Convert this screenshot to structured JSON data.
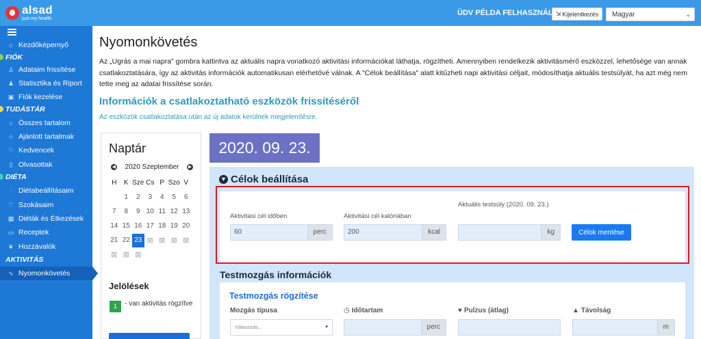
{
  "header": {
    "logo_name": "alsad",
    "logo_tagline": "just my health",
    "greeting": "ÜDV PÉLDA FELHASZNÁLÓ!",
    "logout_label": "Kijelentkezés",
    "language": "Magyar",
    "bar_color": "#3a9ae8"
  },
  "sidebar": {
    "home": "Kezdőképernyő",
    "sections": {
      "fiok": "FIÓK",
      "tudastar": "TUDÁSTÁR",
      "dieta": "DIÉTA",
      "aktivitas": "AKTIVITÁS"
    },
    "items": [
      "Adataim frissítése",
      "Statisztika és Riport",
      "Fiók kezelése",
      "Összes tartalom",
      "Ajánlott tartalmak",
      "Kedvencek",
      "Olvasottak",
      "Diétabeállításaim",
      "Szokásaim",
      "Diéták és Étkezések",
      "Receptek",
      "Hozzávalók",
      "Nyomonkövetés"
    ],
    "active": "Nyomonkövetés"
  },
  "main": {
    "title": "Nyomonkövetés",
    "intro": "Az „Ugrás a mai napra” gombra kattintva az aktuális napra vonatkozó aktivitási információkat láthatja, rögzítheti. Amennyiben rendelkezik aktivitásmérő eszközzel, lehetősége van annak csatlakoztatására, így az aktivitás információk automatikusan elérhetővé válnak. A \"Célok beállítása\" alatt kitűzheti napi aktivitási céljait, módosíthatja aktuális testsúlyát, ha azt még nem tette meg az adatai frissítése során.",
    "devices_title": "Információk a csatlakoztatható eszközök frissítéséről",
    "devices_text": "Az eszközök csatlakoztatása után az új adatok kerülnek megjelenítésre."
  },
  "calendar": {
    "title": "Naptár",
    "month": "2020 Szeptember",
    "weekdays": [
      "H",
      "K",
      "Sze",
      "Cs",
      "P",
      "Szo",
      "V"
    ],
    "weeks": [
      [
        "",
        "1",
        "2",
        "3",
        "4",
        "5",
        "6"
      ],
      [
        "7",
        "8",
        "9",
        "10",
        "11",
        "12",
        "13"
      ],
      [
        "14",
        "15",
        "16",
        "17",
        "18",
        "19",
        "20"
      ],
      [
        "21",
        "22",
        "23",
        "x",
        "x",
        "x",
        "x"
      ],
      [
        "x",
        "x",
        "x",
        "",
        "",
        "",
        ""
      ]
    ],
    "today": "23",
    "legend_title": "Jelölések",
    "legend_count": "1",
    "legend_text": "- van aktivitás rögzítve"
  },
  "date_display": "2020. 09. 23.",
  "goals": {
    "title": "Célok beállítása",
    "time_label": "Aktivitási cél időben",
    "time_value": "60",
    "time_unit": "perc",
    "cal_label": "Aktivitási cél kalóriában",
    "cal_value": "200",
    "cal_unit": "kcal",
    "weight_label": "Aktuális testsúly (2020. 09. 23.)",
    "weight_value": "",
    "weight_unit": "kg",
    "save_label": "Célok mentése"
  },
  "exercise": {
    "title": "Testmozgás információk",
    "sub_title": "Testmozgás rögzítése",
    "type_label": "Mozgás típusa",
    "type_placeholder": "Válasszás...",
    "duration_label": "Időtartam",
    "duration_unit": "perc",
    "pulse_label": "Pulzus (átlag)",
    "distance_label": "Távolság",
    "distance_unit": "m"
  }
}
